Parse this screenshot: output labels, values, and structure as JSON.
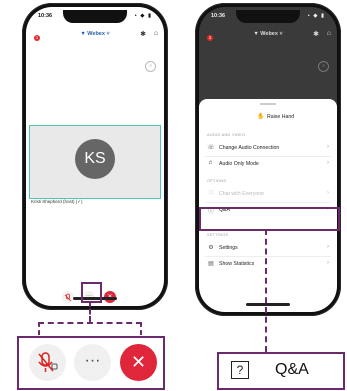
{
  "left_phone": {
    "time": "10:36",
    "status_icons": "• ◆ ▮",
    "app_name": "▼ Webex ˅",
    "bluetooth_icon": "✱",
    "person_icon": "⌂",
    "notification_count": "1",
    "participant_initials": "KS",
    "participant_name": "Kristi Shepherd (host) (✓)"
  },
  "right_phone": {
    "time": "10:36",
    "status_icons": "• ◆ ▮",
    "app_name": "▼ Webex ˅",
    "bluetooth_icon": "✱",
    "person_icon": "⌂",
    "notification_count": "1",
    "raise_hand": "Raise Hand",
    "sections": {
      "audio_video": "AUDIO AND VIDEO",
      "options": "OPTIONS",
      "settings": "SETTINGS"
    },
    "menu": {
      "change_audio": "Change Audio Connection",
      "audio_only": "Audio Only Mode",
      "chat": "Chat with Everyone",
      "qa": "Q&A",
      "settings": "Settings",
      "show_statistics": "Show Statistics"
    }
  },
  "zoom_left": {
    "more_label": "···",
    "end_label": "✕"
  },
  "zoom_right": {
    "qa_icon": "?",
    "qa_label": "Q&A"
  },
  "colors": {
    "accent_callout": "#6b2a6b",
    "end_red": "#e0263a",
    "video_border": "#4cc8b4"
  }
}
